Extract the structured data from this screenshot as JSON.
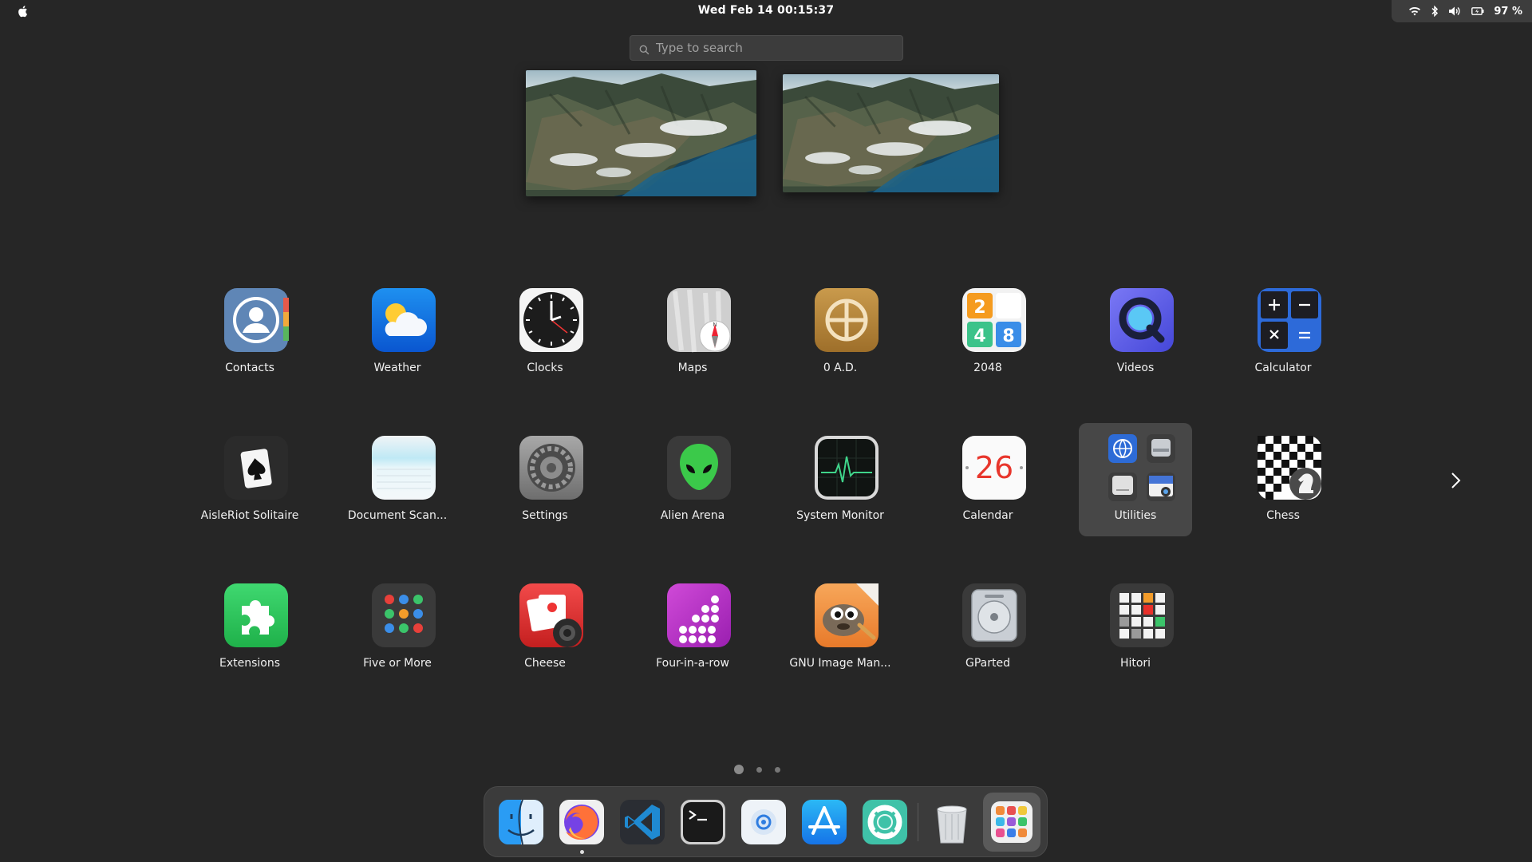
{
  "topbar": {
    "clock": "Wed Feb 14  00:15:37",
    "battery": "97 %",
    "icons": [
      "apple-icon",
      "wifi-icon",
      "bluetooth-icon",
      "volume-icon",
      "battery-icon"
    ]
  },
  "search": {
    "placeholder": "Type to search",
    "value": ""
  },
  "apps": [
    {
      "label": "Contacts",
      "icon": "contacts-icon"
    },
    {
      "label": "Weather",
      "icon": "weather-icon"
    },
    {
      "label": "Clocks",
      "icon": "clocks-icon"
    },
    {
      "label": "Maps",
      "icon": "maps-icon"
    },
    {
      "label": "0 A.D.",
      "icon": "0ad-icon"
    },
    {
      "label": "2048",
      "icon": "2048-icon"
    },
    {
      "label": "Videos",
      "icon": "videos-icon"
    },
    {
      "label": "Calculator",
      "icon": "calculator-icon"
    },
    {
      "label": "AisleRiot Solitaire",
      "icon": "solitaire-icon"
    },
    {
      "label": "Document Scan...",
      "icon": "document-scanner-icon"
    },
    {
      "label": "Settings",
      "icon": "settings-icon"
    },
    {
      "label": "Alien Arena",
      "icon": "alien-arena-icon"
    },
    {
      "label": "System Monitor",
      "icon": "system-monitor-icon"
    },
    {
      "label": "Calendar",
      "icon": "calendar-icon",
      "day": "26"
    },
    {
      "label": "Utilities",
      "icon": "utilities-folder-icon"
    },
    {
      "label": "Chess",
      "icon": "chess-icon"
    },
    {
      "label": "Extensions",
      "icon": "extensions-icon"
    },
    {
      "label": "Five or More",
      "icon": "five-or-more-icon"
    },
    {
      "label": "Cheese",
      "icon": "cheese-icon"
    },
    {
      "label": "Four-in-a-row",
      "icon": "four-in-a-row-icon"
    },
    {
      "label": "GNU Image Man...",
      "icon": "gimp-icon"
    },
    {
      "label": "GParted",
      "icon": "gparted-icon"
    },
    {
      "label": "Hitori",
      "icon": "hitori-icon"
    }
  ],
  "pagination": {
    "pages": 3,
    "current": 1
  },
  "dock": [
    "finder-icon",
    "firefox-icon",
    "vscode-icon",
    "terminal-icon",
    "mail-icon",
    "app-store-icon",
    "help-icon",
    "trash-icon",
    "app-grid-icon"
  ],
  "colors": {
    "background": "#262626",
    "folder": "#474747",
    "dock": "#3b3b3b"
  }
}
